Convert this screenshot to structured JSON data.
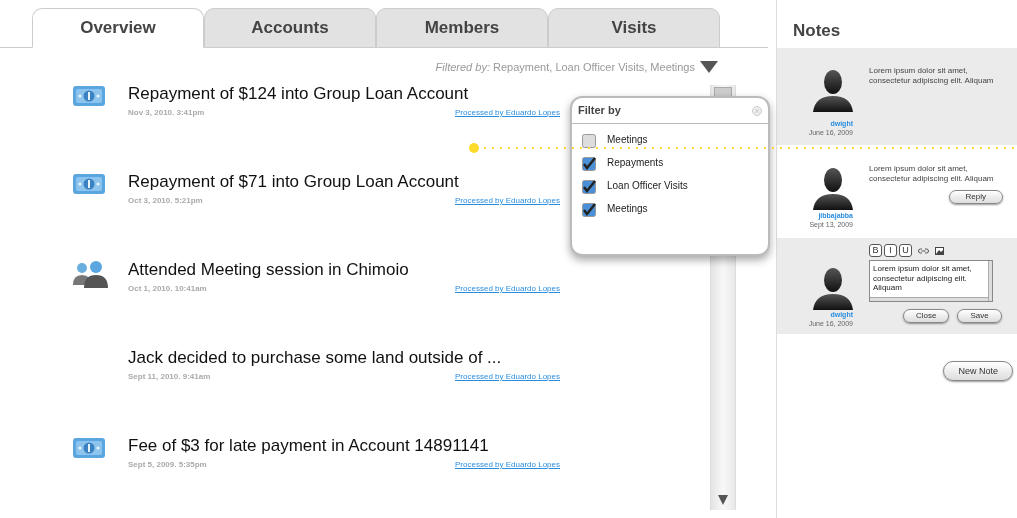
{
  "tabs": [
    {
      "label": "Overview",
      "selected": true
    },
    {
      "label": "Accounts",
      "selected": false
    },
    {
      "label": "Members",
      "selected": false
    },
    {
      "label": "Visits",
      "selected": false
    }
  ],
  "filter": {
    "label": "Filtered by:",
    "value": "Repayment, Loan Officer Visits, Meetings"
  },
  "filter_popup": {
    "title": "Filter by",
    "options": [
      {
        "label": "Meetings",
        "checked": false
      },
      {
        "label": "Repayments",
        "checked": true
      },
      {
        "label": "Loan Officer Visits",
        "checked": true
      },
      {
        "label": "Meetings",
        "checked": true
      }
    ]
  },
  "activity": [
    {
      "kind": "money",
      "title": "Repayment of $124 into Group Loan Account",
      "date": "Nov 3, 2010. 3:41pm",
      "link": "Processed by Eduardo Lopes"
    },
    {
      "kind": "money",
      "title": "Repayment of $71 into Group Loan Account",
      "date": "Oct 3, 2010. 5:21pm",
      "link": "Processed by Eduardo Lopes"
    },
    {
      "kind": "meeting",
      "title": "Attended Meeting session in Chimoio",
      "date": "Oct 1, 2010. 10:41am",
      "link": "Processed by Eduardo Lopes"
    },
    {
      "kind": "note",
      "title": "Jack decided to purchase some land outside of ...",
      "date": "Sept 11, 2010. 9:41am",
      "link": "Processed by Eduardo Lopes"
    },
    {
      "kind": "money",
      "title": "Fee of $3 for late payment in Account 14891141",
      "date": "Sept 5, 2009. 5:35pm",
      "link": "Processed by Eduardo Lopes"
    }
  ],
  "notes": {
    "title": "Notes",
    "items": [
      {
        "kind": "view",
        "text": "Lorem ipsum dolor sit amet, consectetur adipiscing elit. Aliquam",
        "author": "dwight",
        "date": "June 16, 2009"
      },
      {
        "kind": "reply",
        "text": "Lorem ipsum dolor sit amet, consectetur adipiscing elit. Aliquam",
        "author": "jibbajabba",
        "date": "Sept 13, 2009",
        "button": "Reply"
      },
      {
        "kind": "edit",
        "text": "Lorem ipsum dolor sit amet, consectetur adipiscing elit. Aliquam",
        "author": "dwight",
        "date": "June 16, 2009",
        "format_buttons": [
          "B",
          "I",
          "U"
        ],
        "buttons": [
          "Close",
          "Save"
        ]
      }
    ],
    "new_button": "New Note"
  }
}
